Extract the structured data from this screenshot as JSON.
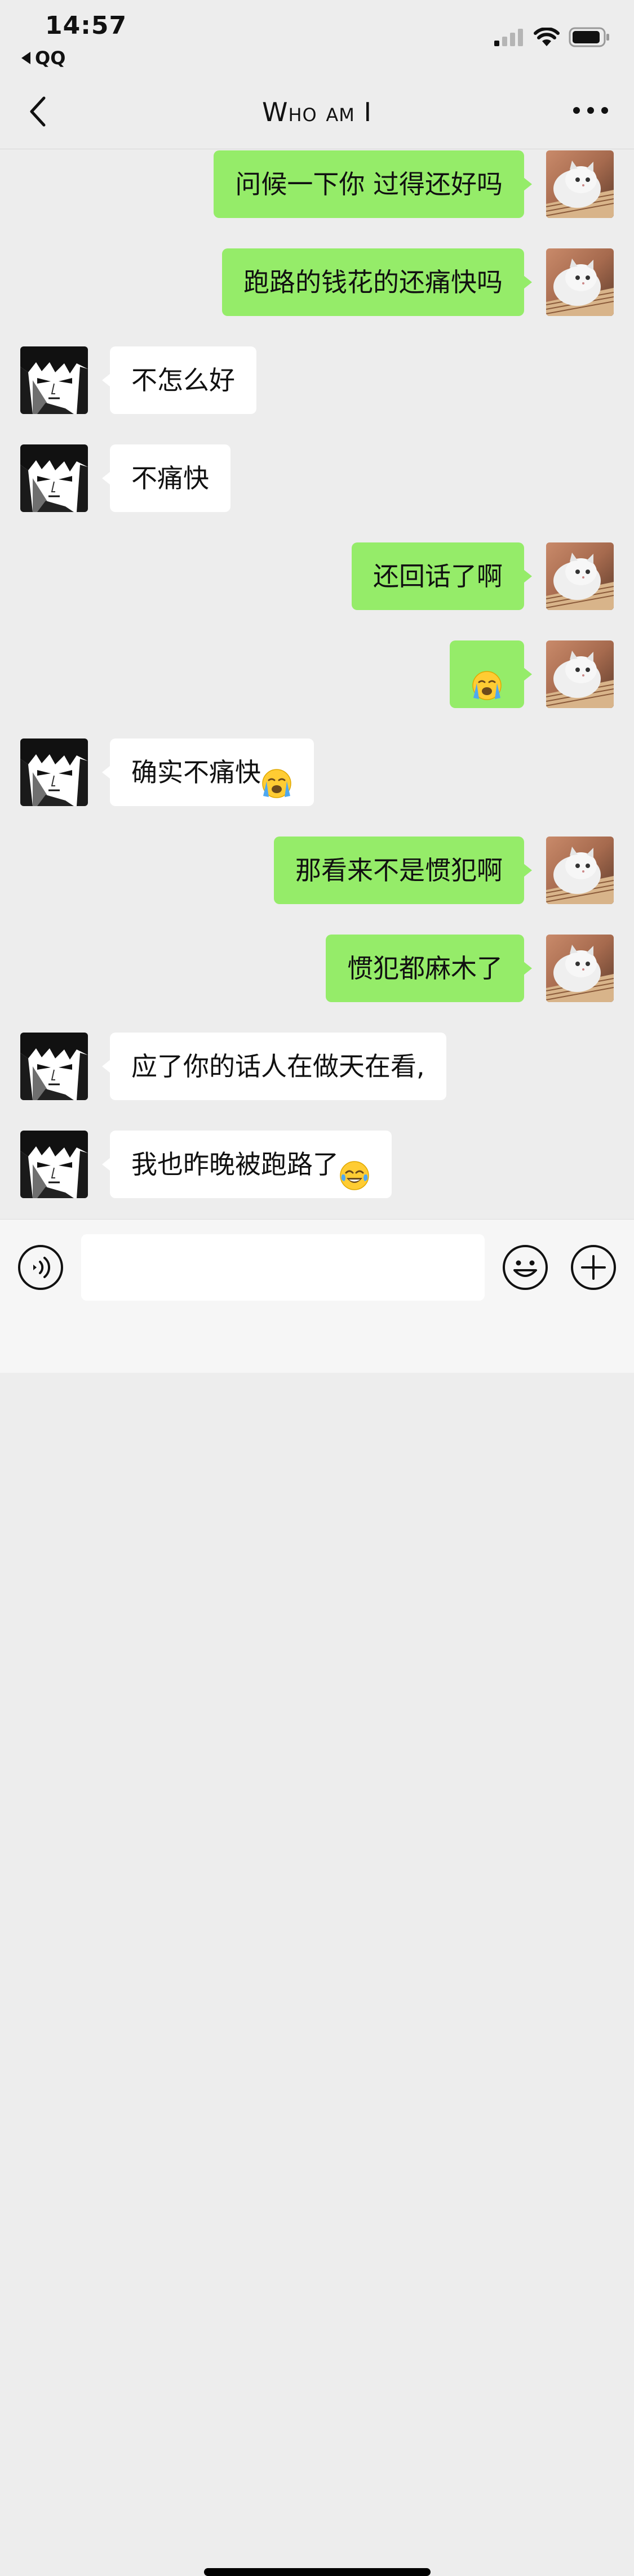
{
  "status_bar": {
    "time": "14:57",
    "back_app_label": "QQ",
    "icons": [
      "cellular-signal-icon",
      "wifi-icon",
      "battery-icon"
    ]
  },
  "nav": {
    "title": "Who am I",
    "icons": [
      "chevron-left-icon",
      "more-dots-icon"
    ]
  },
  "messages": [
    {
      "from": "me",
      "text": "问候一下你  过得还好吗"
    },
    {
      "from": "me",
      "text": "跑路的钱花的还痛快吗"
    },
    {
      "from": "other",
      "text": "不怎么好"
    },
    {
      "from": "other",
      "text": "不痛快"
    },
    {
      "from": "me",
      "text": "还回话了啊"
    },
    {
      "from": "me",
      "text": "",
      "emoji": "loudly-crying-face"
    },
    {
      "from": "other",
      "text": "确实不痛快",
      "emoji": "loudly-crying-face"
    },
    {
      "from": "me",
      "text": "那看来不是惯犯啊"
    },
    {
      "from": "me",
      "text": "惯犯都麻木了"
    },
    {
      "from": "other",
      "text": "应了你的话人在做天在看,"
    },
    {
      "from": "other",
      "text": "我也昨晚被跑路了",
      "emoji": "face-with-tears-of-joy"
    }
  ],
  "input_bar": {
    "value": "",
    "icons": [
      "voice-icon",
      "emoji-icon",
      "plus-icon"
    ]
  },
  "colors": {
    "background": "#EDEDED",
    "sent_bubble": "#95EC69",
    "received_bubble": "#FFFFFF",
    "input_bar": "#F6F6F6"
  }
}
